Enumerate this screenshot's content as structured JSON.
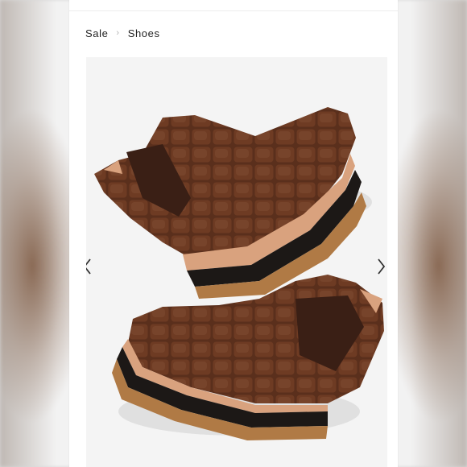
{
  "breadcrumb": {
    "items": [
      "Sale",
      "Shoes"
    ],
    "separator": "›"
  },
  "carousel": {
    "image_subject": "brown-croc-chelsea-boots",
    "prev_icon": "chevron-left-icon",
    "next_icon": "chevron-right-icon"
  },
  "colors": {
    "leather": "#5a2f1c",
    "leather_light": "#7b4a31",
    "sole_dark": "#1c1816",
    "sole_gum": "#b07a45",
    "welt": "#d9a27e"
  }
}
